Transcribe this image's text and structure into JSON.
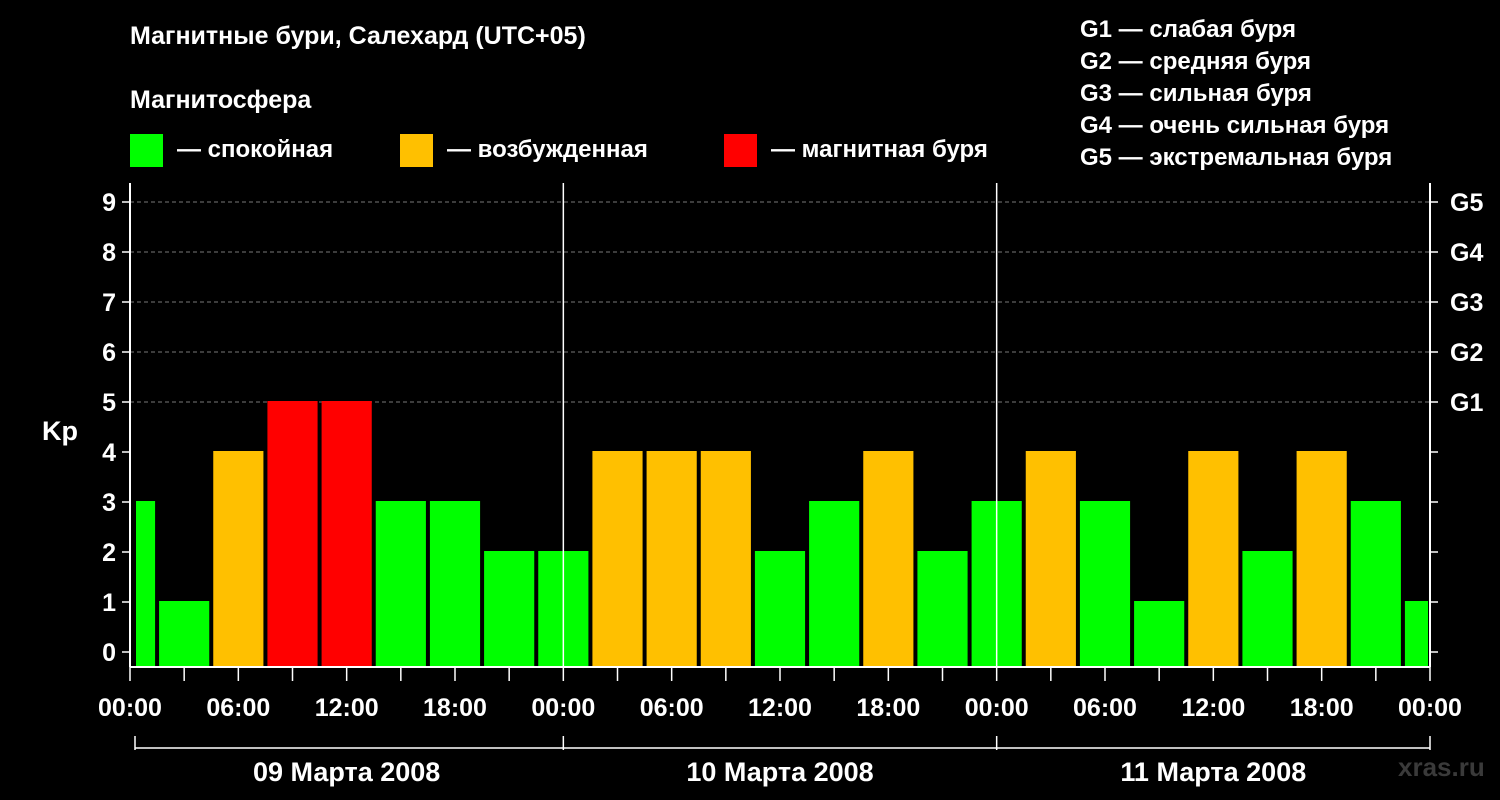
{
  "title": "Магнитные бури, Салехард (UTC+05)",
  "subtitle": "Магнитосфера",
  "legend": [
    {
      "label": "— спокойная",
      "color": "#00ff00"
    },
    {
      "label": "— возбужденная",
      "color": "#ffc000"
    },
    {
      "label": "— магнитная буря",
      "color": "#ff0000"
    }
  ],
  "g_scale": [
    {
      "label": "G1 — слабая буря"
    },
    {
      "label": "G2 — средняя буря"
    },
    {
      "label": "G3 — сильная буря"
    },
    {
      "label": "G4 — очень сильная буря"
    },
    {
      "label": "G5 — экстремальная буря"
    }
  ],
  "watermark": "xras.ru",
  "chart_data": {
    "type": "bar",
    "ylabel": "Kp",
    "ylim": [
      0,
      9
    ],
    "yticks": [
      0,
      1,
      2,
      3,
      4,
      5,
      6,
      7,
      8,
      9
    ],
    "right_ticks": [
      {
        "value": 5,
        "label": "G1"
      },
      {
        "value": 6,
        "label": "G2"
      },
      {
        "value": 7,
        "label": "G3"
      },
      {
        "value": 8,
        "label": "G4"
      },
      {
        "value": 9,
        "label": "G5"
      }
    ],
    "xtick_labels": [
      "00:00",
      "06:00",
      "12:00",
      "18:00",
      "00:00",
      "06:00",
      "12:00",
      "18:00",
      "00:00",
      "06:00",
      "12:00",
      "18:00",
      "00:00"
    ],
    "days": [
      "09 Марта 2008",
      "10 Марта 2008",
      "11 Марта 2008"
    ],
    "grid": "dashed horizontal at 5-9",
    "colors": {
      "quiet": "#00ff00",
      "active": "#ffc000",
      "storm": "#ff0000"
    },
    "values": [
      3,
      1,
      4,
      5,
      5,
      3,
      3,
      2,
      2,
      4,
      4,
      4,
      2,
      3,
      4,
      2,
      3,
      4,
      3,
      1,
      4,
      2,
      4,
      3,
      1
    ]
  }
}
